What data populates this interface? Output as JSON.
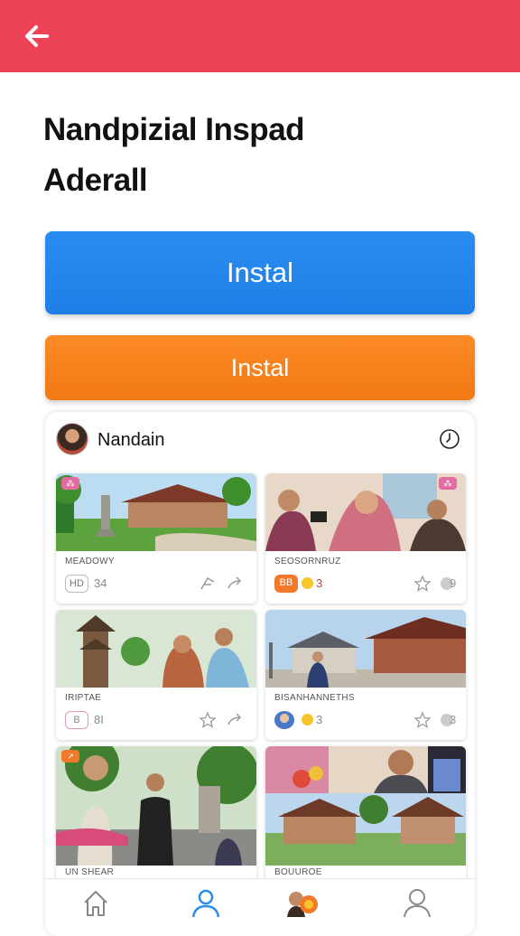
{
  "header": {
    "back_icon": "arrow-left-icon",
    "color": "#ee4257"
  },
  "title_line1": "Nandpizial Inspad",
  "title_line2": "Aderall",
  "buttons": {
    "primary_label": "Instal",
    "secondary_label": "Instal",
    "primary_color": "#1f7fe6",
    "secondary_color": "#f27a14"
  },
  "feed": {
    "user_name": "Nandain",
    "menu_icon": "clock-icon",
    "tiles": [
      {
        "caption": "MEADOWY",
        "tag": "HD",
        "count": "34",
        "icons": [
          "share-icon",
          "forward-icon"
        ]
      },
      {
        "caption": "SEOSORNRUZ",
        "tag": "BB",
        "count": "3",
        "icons": [
          "star-icon",
          "chat-icon"
        ],
        "badge_count": "9"
      },
      {
        "caption": "IRIPTAE",
        "tag": "B",
        "count": "8I",
        "icons": [
          "star-icon",
          "forward-icon"
        ]
      },
      {
        "caption": "BISANHANNETHS",
        "tag": "",
        "count": "3",
        "icons": [
          "star-icon",
          "chat-icon"
        ],
        "badge_count": "3"
      },
      {
        "caption": "UN SHEAR",
        "tag": "",
        "count": "",
        "icons": []
      },
      {
        "caption": "BOUUROE",
        "tag": "",
        "count": "",
        "icons": []
      }
    ]
  },
  "bottom_nav": [
    {
      "name": "home-icon"
    },
    {
      "name": "profile-icon",
      "active": true
    },
    {
      "name": "friends-icon"
    },
    {
      "name": "user-icon"
    }
  ]
}
